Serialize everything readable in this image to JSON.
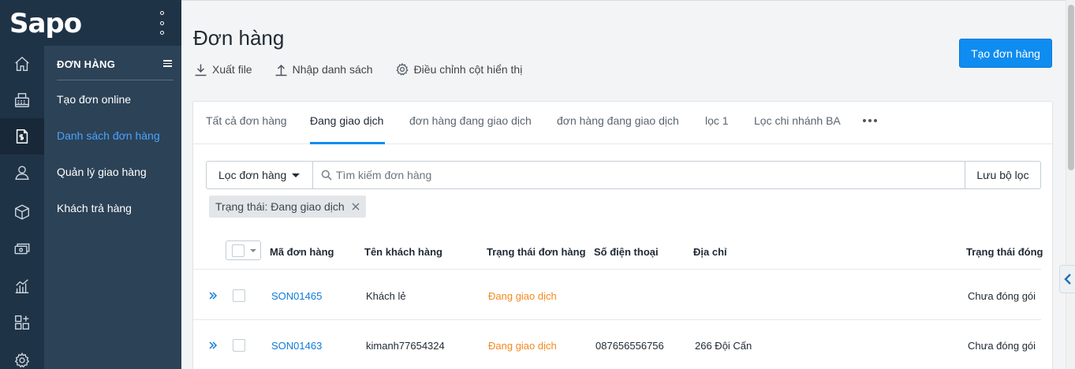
{
  "brand": {
    "logo_text": "Sapo"
  },
  "rail": {
    "icons": [
      "home-icon",
      "pos-icon",
      "orders-icon",
      "customer-icon",
      "product-icon",
      "cash-icon",
      "report-icon",
      "apps-icon",
      "settings-icon"
    ]
  },
  "submenu": {
    "heading": "ĐƠN HÀNG",
    "items": [
      {
        "label": "Tạo đơn online"
      },
      {
        "label": "Danh sách đơn hàng"
      },
      {
        "label": "Quản lý giao hàng"
      },
      {
        "label": "Khách trả hàng"
      }
    ]
  },
  "header": {
    "title": "Đơn hàng",
    "create_button": "Tạo đơn hàng",
    "export_label": "Xuất file",
    "import_label": "Nhập danh sách",
    "columns_label": "Điều chỉnh cột hiển thị"
  },
  "tabs": [
    {
      "label": "Tất cả đơn hàng"
    },
    {
      "label": "Đang giao dịch"
    },
    {
      "label": "đơn hàng đang giao dịch"
    },
    {
      "label": "đơn hàng đang giao dịch"
    },
    {
      "label": "lọc 1"
    },
    {
      "label": "Lọc chi nhánh BA"
    }
  ],
  "filter": {
    "dropdown_label": "Lọc đơn hàng",
    "search_placeholder": "Tìm kiếm đơn hàng",
    "search_value": "",
    "save_label": "Lưu bộ lọc",
    "chip_label": "Trạng thái: Đang giao dịch"
  },
  "table": {
    "columns": [
      "Mã đơn hàng",
      "Tên khách hàng",
      "Trạng thái đơn hàng",
      "Số điện thoại",
      "Địa chỉ",
      "Trạng thái đóng"
    ],
    "rows": [
      {
        "code": "SON01465",
        "customer": "Khách lẻ",
        "status": "Đang giao dịch",
        "phone": "",
        "address": "",
        "pack_status": "Chưa đóng gói"
      },
      {
        "code": "SON01463",
        "customer": "kimanh77654324",
        "status": "Đang giao dịch",
        "phone": "087656556756",
        "address": "266 Đội Cấn",
        "pack_status": "Chưa đóng gói"
      }
    ]
  },
  "colors": {
    "sidebar": "#1f3347",
    "submenu": "#2c4256",
    "accent": "#0f8cf0",
    "active_link": "#4aa3ff",
    "status_orange": "#f5891f"
  }
}
